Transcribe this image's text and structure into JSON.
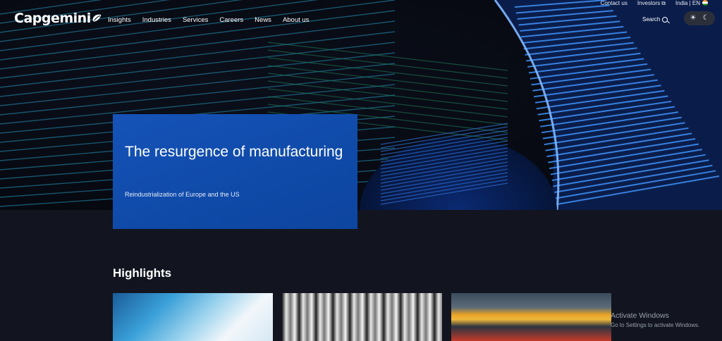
{
  "header": {
    "logo_text": "Capgemini",
    "nav": [
      "Insights",
      "Industries",
      "Services",
      "Careers",
      "News",
      "About us"
    ],
    "utility": {
      "contact": "Contact us",
      "investors": "Investors",
      "external_glyph": "⧉",
      "region": "India | EN"
    },
    "search_label": "Search",
    "theme_icons": {
      "light": "☀",
      "dark": "☾"
    }
  },
  "hero": {
    "title": "The resurgence of manufacturing",
    "subtitle": "Reindustrialization of Europe and the US"
  },
  "highlights": {
    "title": "Highlights"
  },
  "watermark": {
    "line1": "Activate Windows",
    "line2": "Go to Settings to activate Windows."
  },
  "colors": {
    "page_bg": "#12151f",
    "hero_card": "#1653b8",
    "accent_blue": "#2a7cf0"
  },
  "icons": [
    "capgemini-spade-icon",
    "external-link-icon",
    "india-flag-icon",
    "search-icon",
    "sun-icon",
    "moon-icon"
  ]
}
